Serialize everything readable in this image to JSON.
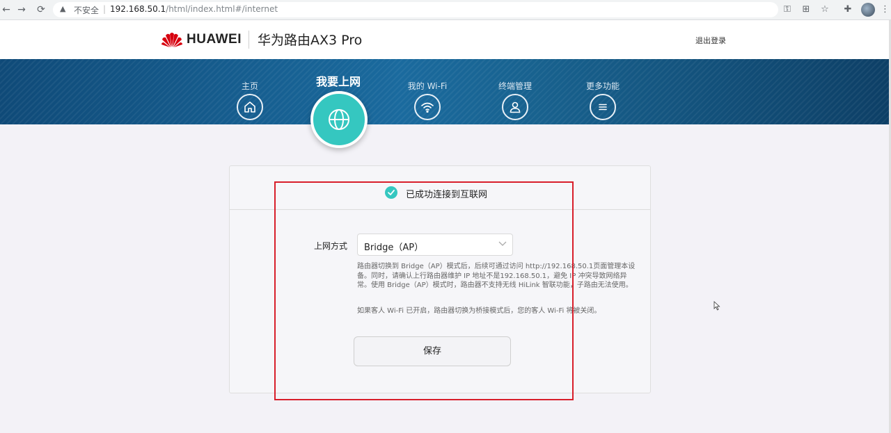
{
  "browser": {
    "insecure_label": "不安全",
    "url_host": "192.168.50.1",
    "url_path": "/html/index.html#/internet"
  },
  "header": {
    "brand": "HUAWEI",
    "product": "华为路由AX3 Pro",
    "logout": "退出登录"
  },
  "nav": {
    "items": [
      {
        "label": "主页",
        "icon": "home-icon"
      },
      {
        "label": "我要上网",
        "icon": "globe-icon",
        "active": true
      },
      {
        "label": "我的 Wi-Fi",
        "icon": "wifi-icon"
      },
      {
        "label": "终端管理",
        "icon": "user-icon"
      },
      {
        "label": "更多功能",
        "icon": "menu-icon"
      }
    ]
  },
  "main": {
    "status": "已成功连接到互联网",
    "field_label": "上网方式",
    "mode_value": "Bridge（AP）",
    "description": "路由器切换到 Bridge（AP）模式后，后续可通过访问 http://192.168.50.1页面管理本设备。同时，请确认上行路由器维护 IP 地址不是192.168.50.1，避免 IP 冲突导致网络异常。使用 Bridge（AP）模式时，路由器不支持无线 HiLink 智联功能，子路由无法使用。",
    "note": "如果客人 Wi-Fi 已开启，路由器切换为桥接模式后，您的客人 Wi-Fi 将被关闭。",
    "save_label": "保存"
  },
  "colors": {
    "accent": "#35c7c0",
    "banner": "#1a6a9e",
    "annotation": "#d81e2a"
  }
}
